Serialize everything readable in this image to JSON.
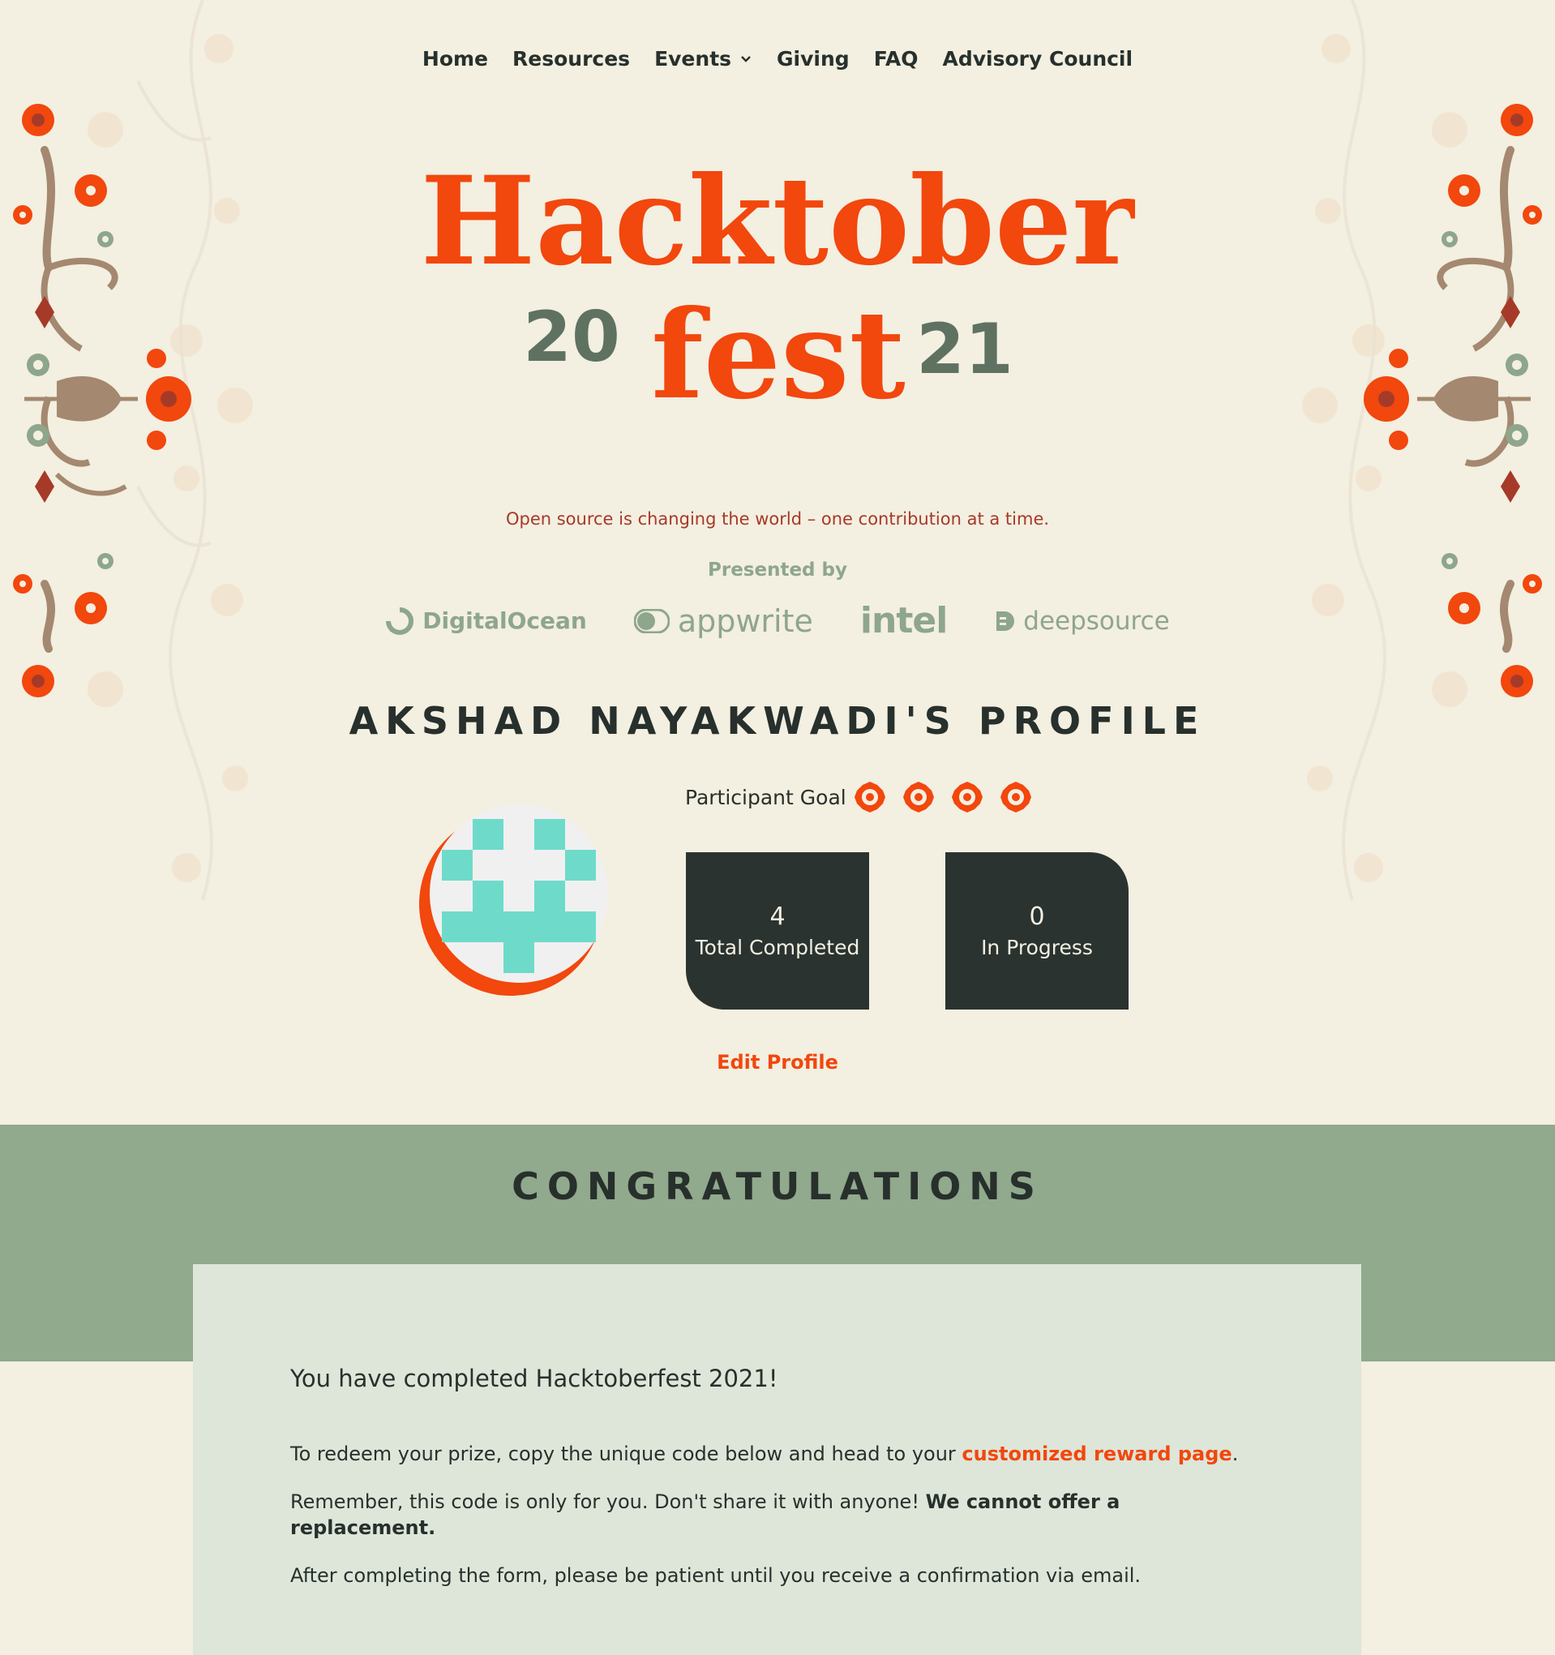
{
  "nav": {
    "items": [
      {
        "label": "Home"
      },
      {
        "label": "Resources"
      },
      {
        "label": "Events",
        "has_dropdown": true
      },
      {
        "label": "Giving"
      },
      {
        "label": "FAQ"
      },
      {
        "label": "Advisory Council"
      }
    ]
  },
  "logo": {
    "line1": "Hacktober",
    "line2": "fest",
    "year_left": "20",
    "year_right": "21"
  },
  "tagline": "Open source is changing the world – one contribution at a time.",
  "presented_by": "Presented by",
  "sponsors": [
    {
      "name": "DigitalOcean"
    },
    {
      "name": "appwrite"
    },
    {
      "name": "intel"
    },
    {
      "name": "deepsource"
    }
  ],
  "profile": {
    "title": "AKSHAD NAYAKWADI'S PROFILE",
    "goal_label": "Participant Goal",
    "goal_count": 4,
    "total_completed_value": "4",
    "total_completed_label": "Total Completed",
    "in_progress_value": "0",
    "in_progress_label": "In Progress",
    "edit_label": "Edit Profile"
  },
  "congrats": {
    "title": "CONGRATULATIONS",
    "heading": "You have completed Hacktoberfest 2021!",
    "p1_before": "To redeem your prize, copy the unique code below and head to your ",
    "p1_link": "customized reward page",
    "p1_after": ".",
    "p2_before": "Remember, this code is only for you. Don't share it with anyone! ",
    "p2_strong": "We cannot offer a replacement.",
    "p3": "After completing the form, please be patient until you receive a confirmation via email."
  },
  "colors": {
    "background": "#f3efe1",
    "accent_orange": "#f2470d",
    "dark": "#2a3330",
    "sage": "#91a98c",
    "card": "#dde6d9",
    "tagline_red": "#a63a28"
  }
}
